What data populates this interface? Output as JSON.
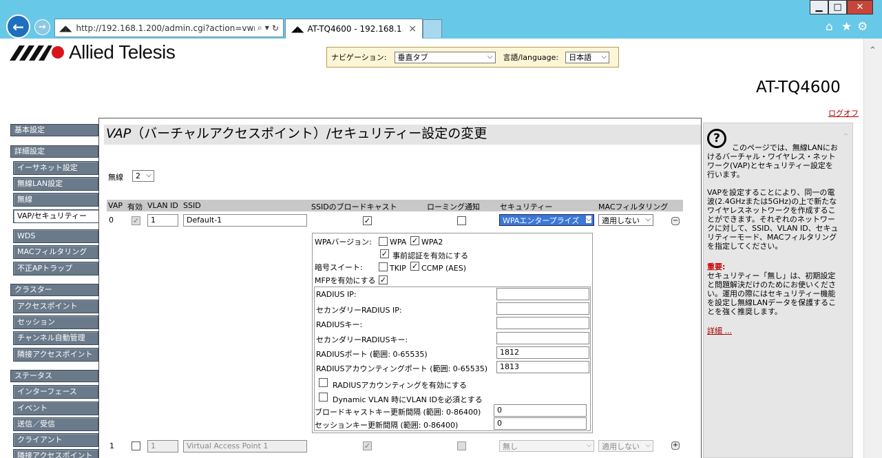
{
  "browser": {
    "address": "http://192.168.1.200/admin.cgi?action=vwr",
    "tab_title": "AT-TQ4600 - 192.168.1....",
    "tab_close": "×",
    "win_min": "▁",
    "win_max": "□",
    "win_close": "✕",
    "icons": [
      "back-icon",
      "forward-icon",
      "search-icon",
      "refresh-icon",
      "home-icon",
      "star-icon",
      "gear-icon"
    ]
  },
  "header": {
    "brand": "Allied Telesis",
    "nav_label": "ナビゲーション:",
    "nav_value": "垂直タブ",
    "lang_label": "言語/language:",
    "lang_value": "日本語",
    "model": "AT-TQ4600",
    "logoff": "ログオフ"
  },
  "sidebar": {
    "groups": [
      {
        "label": "基本設定"
      },
      {
        "label": "詳細設定",
        "items": [
          "イーサネット設定",
          "無線LAN設定",
          "無線",
          "VAP/セキュリティー",
          "WDS",
          "MACフィルタリング",
          "不正APトラップ"
        ]
      },
      {
        "label": "クラスター",
        "items": [
          "アクセスポイント",
          "セッション",
          "チャンネル自動管理",
          "隣接アクセスポイント"
        ]
      },
      {
        "label": "ステータス",
        "items": [
          "インターフェース",
          "イベント",
          "送信／受信",
          "クライアント",
          "隣接アクセスポイント"
        ]
      }
    ],
    "active": "VAP/セキュリティー"
  },
  "main": {
    "title_prefix": "VAP",
    "title_rest": "（バーチャルアクセスポイント）/セキュリティー設定の変更",
    "radio_label": "無線",
    "radio_value": "2",
    "columns": [
      "VAP",
      "有効",
      "VLAN ID",
      "SSID",
      "SSIDのブロードキャスト",
      "ローミング通知",
      "セキュリティー",
      "MACフィルタリング"
    ],
    "rows": [
      {
        "vap": "0",
        "vlan": "1",
        "ssid": "Default-1",
        "security": "WPAエンタープライズ",
        "mac": "適用しない",
        "toggle": "−"
      },
      {
        "vap": "1",
        "vlan": "1",
        "ssid": "Virtual Access Point 1",
        "security": "無し",
        "mac": "適用しない",
        "toggle": "+"
      }
    ],
    "security": {
      "wpa_version_label": "WPAバージョン:",
      "wpa": "WPA",
      "wpa2": "WPA2",
      "preauth": "事前認証を有効にする",
      "cipher_label": "暗号スイート:",
      "tkip": "TKIP",
      "ccmp": "CCMP (AES)",
      "mfp": "MFPを有効にする",
      "radius_ip": "RADIUS IP:",
      "sec_radius_ip": "セカンダリーRADIUS IP:",
      "radius_key": "RADIUSキー:",
      "sec_radius_key": "セカンダリーRADIUSキー:",
      "radius_port_label": "RADIUSポート (範囲: 0-65535)",
      "radius_port": "1812",
      "acct_port_label": "RADIUSアカウンティングポート (範囲: 0-65535)",
      "acct_port": "1813",
      "acct_enable": "RADIUSアカウンティングを有効にする",
      "dyn_vlan": "Dynamic VLAN 時にVLAN IDを必須とする",
      "bcast_key_label": "ブロードキャストキー更新間隔 (範囲: 0-86400)",
      "bcast_key": "0",
      "session_key_label": "セッションキー更新間隔 (範囲: 0-86400)",
      "session_key": "0"
    }
  },
  "help": {
    "intro": "このページでは、無線LANにおけるバーチャル・ワイヤレス・ネットワーク(VAP)とセキュリティー設定を行います。",
    "para2": "VAPを設定することにより、同一の電波(2.4GHzまたは5GHz)の上で新たなワイヤレスネットワークを作成することができます。それぞれのネットワークに対して、SSID、VLAN ID、セキュリティーモード、MACフィルタリングを指定してください。",
    "important_label": "重要:",
    "important": "セキュリティー「無し」は、初期設定と問題解決だけのためにお使いください。運用の際にはセキュリティー機能を設定し無線LANデータを保護することを強く推奨します。",
    "more": "詳細 ..."
  }
}
